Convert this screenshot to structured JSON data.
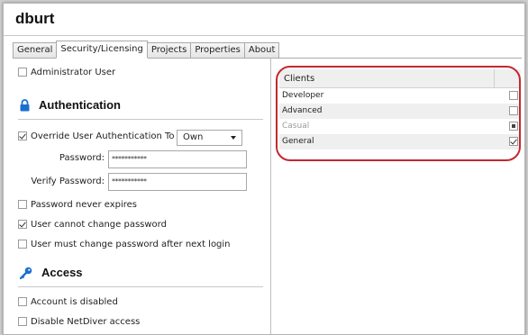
{
  "window": {
    "title": "dburt"
  },
  "tabs": [
    {
      "label": "General",
      "active": false
    },
    {
      "label": "Security/Licensing",
      "active": true
    },
    {
      "label": "Projects",
      "active": false
    },
    {
      "label": "Properties",
      "active": false
    },
    {
      "label": "About",
      "active": false
    }
  ],
  "security": {
    "administrator_user": {
      "label": "Administrator User",
      "checked": false
    },
    "authentication": {
      "heading": "Authentication",
      "icon": "lock-icon",
      "override": {
        "label": "Override User Authentication To",
        "checked": true
      },
      "override_select": {
        "value": "Own"
      },
      "password": {
        "label": "Password:",
        "value": "***********"
      },
      "verify_password": {
        "label": "Verify Password:",
        "value": "***********"
      },
      "never_expires": {
        "label": "Password never expires",
        "checked": false
      },
      "cannot_change": {
        "label": "User cannot change password",
        "checked": true
      },
      "must_change": {
        "label": "User must change password after next login",
        "checked": false
      }
    },
    "access": {
      "heading": "Access",
      "icon": "key-icon",
      "account_disabled": {
        "label": "Account is disabled",
        "checked": false
      },
      "disable_netdiver": {
        "label": "Disable NetDiver access",
        "checked": false
      }
    }
  },
  "clients": {
    "header": "Clients",
    "rows": [
      {
        "name": "Developer",
        "state": "unchecked",
        "enabled": true
      },
      {
        "name": "Advanced",
        "state": "unchecked",
        "enabled": true
      },
      {
        "name": "Casual",
        "state": "partial",
        "enabled": false
      },
      {
        "name": "General",
        "state": "checked",
        "enabled": true
      }
    ]
  },
  "colors": {
    "highlight_oval": "#c4282f",
    "icon_blue": "#1a6fd1",
    "row_alt": "#efefef"
  }
}
